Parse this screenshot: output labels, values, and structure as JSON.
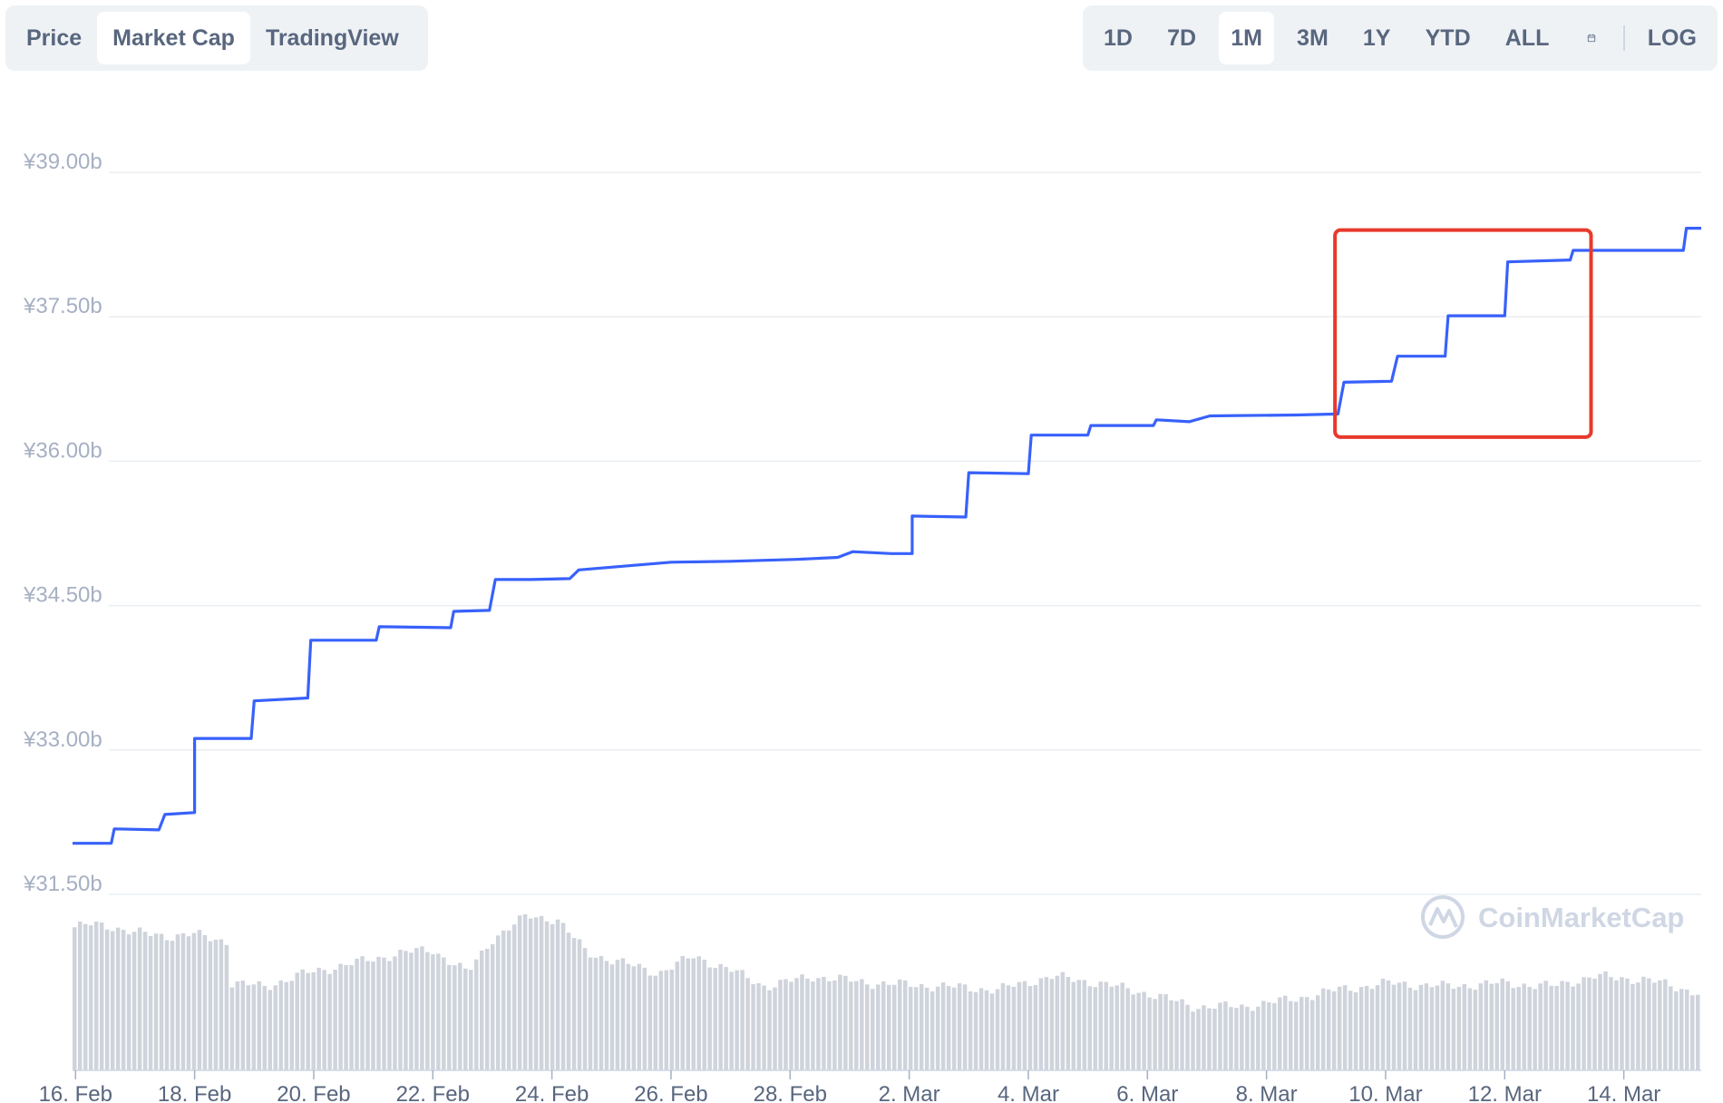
{
  "tabs_left": [
    {
      "label": "Price",
      "active": false
    },
    {
      "label": "Market Cap",
      "active": true
    },
    {
      "label": "TradingView",
      "active": false
    }
  ],
  "tabs_right": [
    {
      "label": "1D",
      "active": false
    },
    {
      "label": "7D",
      "active": false
    },
    {
      "label": "1M",
      "active": true
    },
    {
      "label": "3M",
      "active": false
    },
    {
      "label": "1Y",
      "active": false
    },
    {
      "label": "YTD",
      "active": false
    },
    {
      "label": "ALL",
      "active": false
    }
  ],
  "calendar_icon": "calendar-icon",
  "log_label": "LOG",
  "watermark": "CoinMarketCap",
  "colors": {
    "line": "#3861fb",
    "highlight": "#e8392b",
    "volume": "#cfd3db",
    "grid": "#eaedf2"
  },
  "chart_data": {
    "type": "line",
    "title": "",
    "xlabel": "",
    "ylabel": "",
    "ylim": [
      31.5,
      39.0
    ],
    "y_ticks": [
      "¥31.50b",
      "¥33.00b",
      "¥34.50b",
      "¥36.00b",
      "¥37.50b",
      "¥39.00b"
    ],
    "x_ticks": [
      "16. Feb",
      "18. Feb",
      "20. Feb",
      "22. Feb",
      "24. Feb",
      "26. Feb",
      "28. Feb",
      "2. Mar",
      "4. Mar",
      "6. Mar",
      "8. Mar",
      "10. Mar",
      "12. Mar",
      "14. Mar"
    ],
    "x_range_days": [
      15.95,
      43.3
    ],
    "series": [
      {
        "points": [
          [
            15.95,
            32.03
          ],
          [
            16.6,
            32.03
          ],
          [
            16.65,
            32.18
          ],
          [
            17.4,
            32.17
          ],
          [
            17.5,
            32.33
          ],
          [
            18.0,
            32.35
          ],
          [
            18.0,
            33.12
          ],
          [
            18.95,
            33.12
          ],
          [
            19.0,
            33.51
          ],
          [
            19.9,
            33.54
          ],
          [
            19.95,
            34.14
          ],
          [
            21.05,
            34.14
          ],
          [
            21.1,
            34.28
          ],
          [
            22.3,
            34.27
          ],
          [
            22.35,
            34.44
          ],
          [
            22.95,
            34.45
          ],
          [
            23.05,
            34.77
          ],
          [
            23.65,
            34.77
          ],
          [
            24.3,
            34.78
          ],
          [
            24.45,
            34.87
          ],
          [
            26.0,
            34.95
          ],
          [
            27.0,
            34.96
          ],
          [
            28.1,
            34.98
          ],
          [
            28.8,
            35.0
          ],
          [
            29.05,
            35.06
          ],
          [
            29.7,
            35.04
          ],
          [
            30.05,
            35.04
          ],
          [
            30.05,
            35.43
          ],
          [
            30.95,
            35.42
          ],
          [
            31.0,
            35.88
          ],
          [
            32.0,
            35.87
          ],
          [
            32.05,
            36.27
          ],
          [
            33.0,
            36.27
          ],
          [
            33.05,
            36.37
          ],
          [
            34.1,
            36.37
          ],
          [
            34.15,
            36.43
          ],
          [
            34.7,
            36.41
          ],
          [
            35.05,
            36.47
          ],
          [
            36.5,
            36.48
          ],
          [
            37.2,
            36.49
          ],
          [
            37.3,
            36.82
          ],
          [
            38.1,
            36.83
          ],
          [
            38.2,
            37.09
          ],
          [
            39.0,
            37.09
          ],
          [
            39.05,
            37.51
          ],
          [
            40.0,
            37.51
          ],
          [
            40.05,
            38.07
          ],
          [
            41.1,
            38.09
          ],
          [
            41.15,
            38.19
          ],
          [
            43.0,
            38.19
          ],
          [
            43.05,
            38.42
          ],
          [
            43.3,
            38.42
          ]
        ]
      }
    ],
    "highlight_box_days": [
      37.15,
      41.45
    ],
    "highlight_box_values": [
      36.25,
      38.4
    ],
    "volume_profile": [
      [
        15.95,
        0.85
      ],
      [
        16.3,
        0.87
      ],
      [
        16.6,
        0.86
      ],
      [
        17.0,
        0.82
      ],
      [
        17.6,
        0.8
      ],
      [
        18.0,
        0.81
      ],
      [
        18.55,
        0.77
      ],
      [
        18.6,
        0.52
      ],
      [
        19.2,
        0.5
      ],
      [
        19.9,
        0.58
      ],
      [
        20.7,
        0.64
      ],
      [
        21.5,
        0.7
      ],
      [
        22.0,
        0.72
      ],
      [
        22.6,
        0.58
      ],
      [
        23.0,
        0.78
      ],
      [
        23.6,
        0.92
      ],
      [
        24.1,
        0.9
      ],
      [
        24.6,
        0.7
      ],
      [
        25.2,
        0.64
      ],
      [
        25.8,
        0.58
      ],
      [
        26.4,
        0.68
      ],
      [
        27.0,
        0.6
      ],
      [
        27.6,
        0.5
      ],
      [
        28.4,
        0.56
      ],
      [
        29.4,
        0.52
      ],
      [
        30.6,
        0.5
      ],
      [
        31.5,
        0.48
      ],
      [
        32.4,
        0.56
      ],
      [
        33.2,
        0.52
      ],
      [
        34.0,
        0.46
      ],
      [
        34.8,
        0.38
      ],
      [
        35.6,
        0.38
      ],
      [
        36.4,
        0.42
      ],
      [
        37.2,
        0.48
      ],
      [
        38.1,
        0.52
      ],
      [
        39.0,
        0.5
      ],
      [
        40.0,
        0.52
      ],
      [
        40.8,
        0.5
      ],
      [
        41.5,
        0.56
      ],
      [
        42.4,
        0.54
      ],
      [
        43.3,
        0.46
      ]
    ]
  }
}
